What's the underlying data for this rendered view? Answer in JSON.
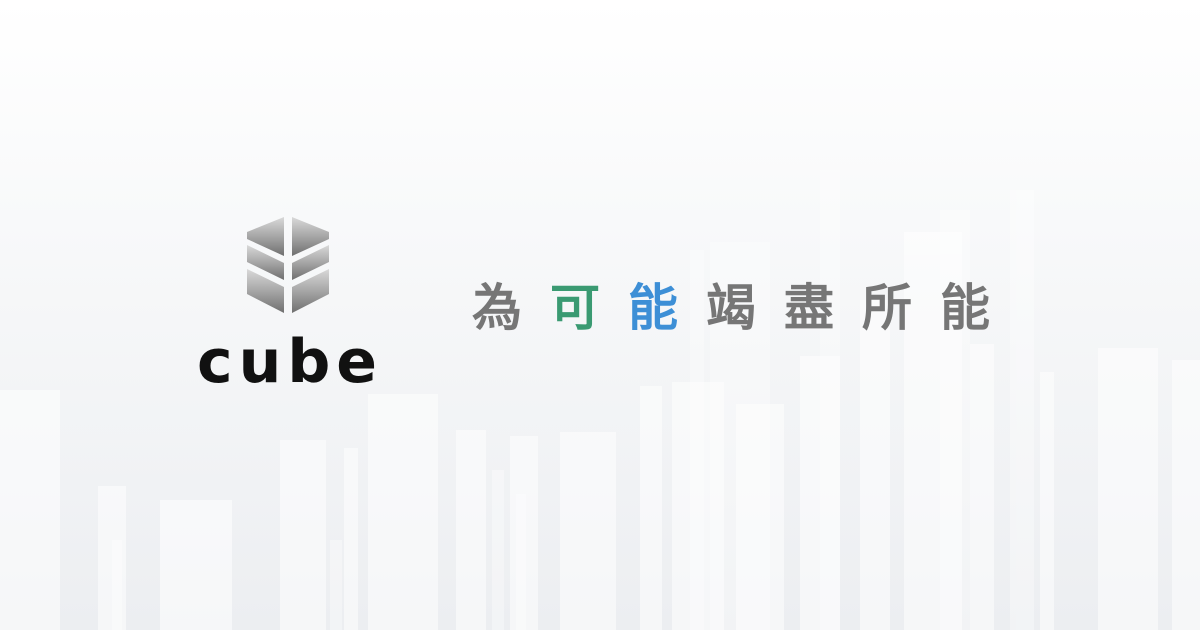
{
  "brand": {
    "name": "cube",
    "logo_icon": "layered-cube-icon"
  },
  "tagline": {
    "chars": [
      {
        "text": "為",
        "color": "#767676"
      },
      {
        "text": "可",
        "color": "#3a9a72"
      },
      {
        "text": "能",
        "color": "#3d8fd6"
      },
      {
        "text": "竭",
        "color": "#767676"
      },
      {
        "text": "盡",
        "color": "#767676"
      },
      {
        "text": "所",
        "color": "#767676"
      },
      {
        "text": "能",
        "color": "#767676"
      }
    ]
  },
  "colors": {
    "background": "#f4f5f7",
    "logo_text": "#111111",
    "logo_mark_light": "#d9d9d9",
    "logo_mark_dark": "#6f6f6f",
    "skyline": "#ffffff"
  }
}
